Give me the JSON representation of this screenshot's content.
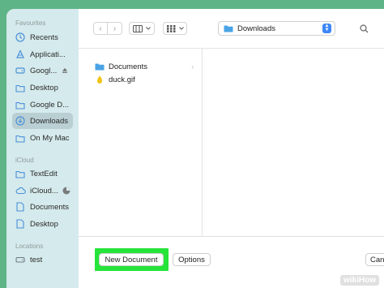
{
  "sidebar": {
    "favourites_title": "Favourites",
    "favourites": [
      {
        "label": "Recents",
        "icon": "clock-icon"
      },
      {
        "label": "Applicati...",
        "icon": "apps-icon"
      },
      {
        "label": "Googl...",
        "icon": "drive-icon",
        "eject": true
      },
      {
        "label": "Desktop",
        "icon": "folder-icon"
      },
      {
        "label": "Google D...",
        "icon": "folder-icon"
      },
      {
        "label": "Downloads",
        "icon": "download-icon",
        "selected": true
      },
      {
        "label": "On My Mac",
        "icon": "folder-icon"
      }
    ],
    "icloud_title": "iCloud",
    "icloud": [
      {
        "label": "TextEdit",
        "icon": "folder-icon"
      },
      {
        "label": "iCloud...",
        "icon": "cloud-icon"
      },
      {
        "label": "Documents",
        "icon": "document-icon"
      },
      {
        "label": "Desktop",
        "icon": "document-icon"
      }
    ],
    "locations_title": "Locations",
    "locations": [
      {
        "label": "test",
        "icon": "disk-icon"
      }
    ]
  },
  "toolbar": {
    "back_glyph": "‹",
    "forward_glyph": "›",
    "location": "Downloads"
  },
  "browser": {
    "items": [
      {
        "name": "Documents",
        "type": "folder"
      },
      {
        "name": "duck.gif",
        "type": "file"
      }
    ]
  },
  "footer": {
    "new_document": "New Document",
    "options": "Options",
    "cancel": "Canc"
  },
  "watermark": "wikiHow",
  "colors": {
    "background": "#5fb487",
    "sidebar": "#d5eaec",
    "highlight": "#26e43a",
    "accent": "#3d86f7",
    "folder": "#4aa3e6"
  }
}
